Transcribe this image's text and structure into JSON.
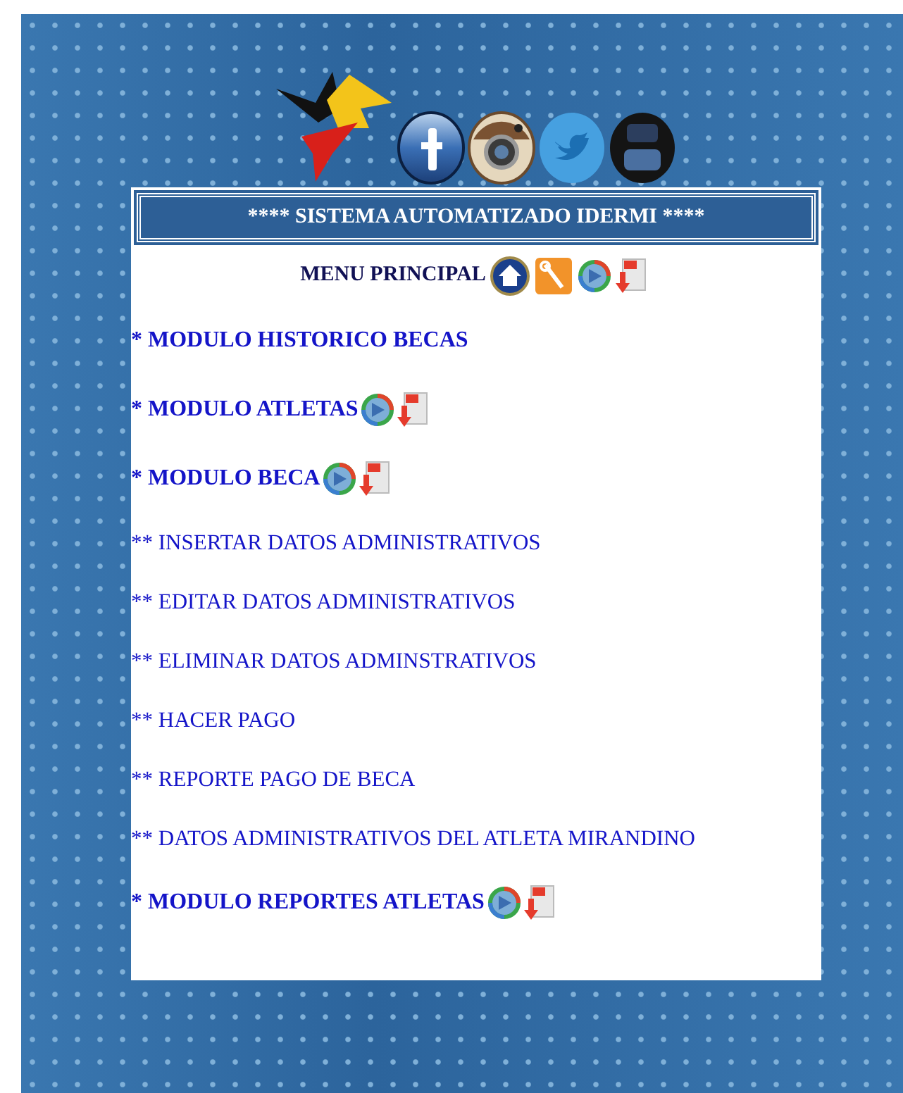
{
  "title": "**** SISTEMA AUTOMATIZADO IDERMI ****",
  "menu": {
    "label": "MENU PRINCIPAL"
  },
  "items": [
    {
      "kind": "module",
      "text": "* MODULO HISTORICO BECAS",
      "icons": false
    },
    {
      "kind": "module",
      "text": "* MODULO ATLETAS",
      "icons": true
    },
    {
      "kind": "module",
      "text": "* MODULO BECA",
      "icons": true
    },
    {
      "kind": "action",
      "text": "** INSERTAR DATOS ADMINISTRATIVOS",
      "icons": false
    },
    {
      "kind": "action",
      "text": "** EDITAR DATOS ADMINISTRATIVOS",
      "icons": false
    },
    {
      "kind": "action",
      "text": "** ELIMINAR DATOS ADMINSTRATIVOS",
      "icons": false
    },
    {
      "kind": "action",
      "text": "** HACER PAGO",
      "icons": false
    },
    {
      "kind": "action",
      "text": "** REPORTE PAGO DE BECA",
      "icons": false
    },
    {
      "kind": "action",
      "text": "** DATOS ADMINISTRATIVOS DEL ATLETA MIRANDINO",
      "icons": false
    },
    {
      "kind": "module",
      "text": "* MODULO REPORTES ATLETAS",
      "icons": true
    }
  ]
}
